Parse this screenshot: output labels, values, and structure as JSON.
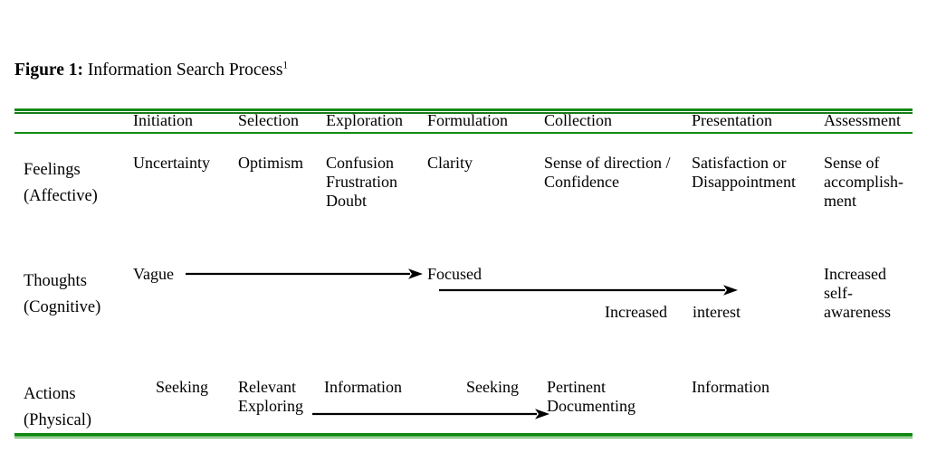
{
  "figure": {
    "caption_label": "Figure 1:",
    "caption_text": " Information Search Process",
    "caption_superscript": "1"
  },
  "colors": {
    "rule_green": "#138a13",
    "text_black": "#000000",
    "background": "#ffffff"
  },
  "table": {
    "row_header_label": "",
    "columns": [
      {
        "label": "Initiation"
      },
      {
        "label": "Selection"
      },
      {
        "label": "Exploration"
      },
      {
        "label": "Formulation"
      },
      {
        "label": "Collection"
      },
      {
        "label": "Presentation"
      },
      {
        "label": "Assessment"
      }
    ],
    "rows": [
      {
        "label": "Feelings\n(Affective)",
        "cells": [
          "Uncertainty",
          "Optimism",
          "Confusion\nFrustration\nDoubt",
          "Clarity",
          "Sense of direction /\nConfidence",
          "Satisfaction or\nDisappointment",
          "Sense of\naccomplish-\nment"
        ]
      },
      {
        "label": "Thoughts\n(Cognitive)",
        "cells": [
          "Vague",
          "",
          "",
          "Focused",
          "",
          "",
          "Increased\nself-\nawareness"
        ],
        "sublabels": [
          {
            "text": "Increased"
          },
          {
            "text": "interest"
          }
        ]
      },
      {
        "label": "Actions\n(Physical)",
        "cells": [
          "Seeking",
          "Relevant\nExploring",
          "Information",
          "Seeking",
          "Pertinent\nDocumenting",
          "Information",
          ""
        ]
      }
    ],
    "arrows": [
      {
        "name": "vague-to-focused-arrow"
      },
      {
        "name": "focused-to-increased-interest-arrow"
      },
      {
        "name": "information-seeking-documenting-arrow"
      }
    ]
  }
}
